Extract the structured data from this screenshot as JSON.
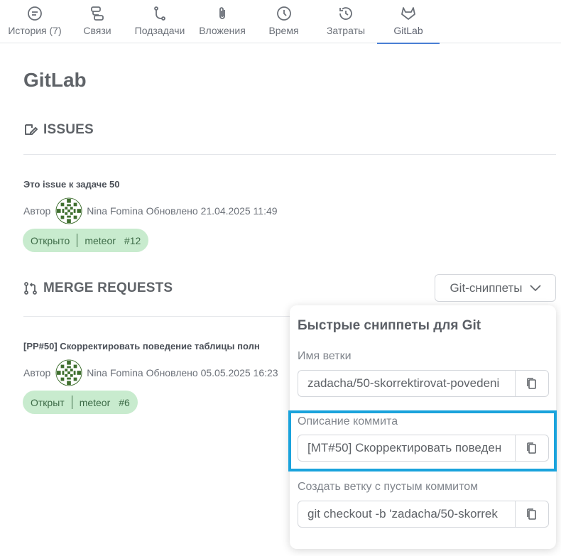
{
  "tabs": [
    {
      "label": "История (7)",
      "icon": "history-icon"
    },
    {
      "label": "Связи",
      "icon": "links-icon"
    },
    {
      "label": "Подзадачи",
      "icon": "subtasks-icon"
    },
    {
      "label": "Вложения",
      "icon": "paperclip-icon"
    },
    {
      "label": "Время",
      "icon": "clock-icon"
    },
    {
      "label": "Затраты",
      "icon": "costs-icon"
    },
    {
      "label": "GitLab",
      "icon": "gitlab-icon",
      "active": true
    }
  ],
  "page": {
    "title": "GitLab"
  },
  "issues": {
    "heading": "ISSUES",
    "items": [
      {
        "title": "Это issue к задаче 50",
        "author_label": "Автор",
        "author": "Nina Fomina",
        "updated": "Обновлено 21.04.2025 11:49",
        "status": "Открыто",
        "project": "meteor",
        "number": "#12"
      }
    ]
  },
  "merge_requests": {
    "heading": "MERGE REQUESTS",
    "items": [
      {
        "title": "[PP#50] Скорректировать поведение таблицы полн",
        "author_label": "Автор",
        "author": "Nina Fomina",
        "updated": "Обновлено 05.05.2025 16:23",
        "status": "Открыт",
        "project": "meteor",
        "number": "#6"
      }
    ]
  },
  "snippets": {
    "button_label": "Git-сниппеты",
    "panel_title": "Быстрые сниппеты для Git",
    "fields": [
      {
        "label": "Имя ветки",
        "value": "zadacha/50-skorrektirovat-povedeni"
      },
      {
        "label": "Описание коммита",
        "value": "[MT#50] Скорректировать поведен"
      },
      {
        "label": "Создать ветку с пустым коммитом",
        "value": "git checkout -b 'zadacha/50-skorrek"
      }
    ]
  },
  "colors": {
    "accent": "#4a7fd4",
    "status_bg": "#c8ebce",
    "status_text": "#3d6b47",
    "highlight": "#1aa3dc",
    "avatar_green": "#3f6f2f"
  }
}
